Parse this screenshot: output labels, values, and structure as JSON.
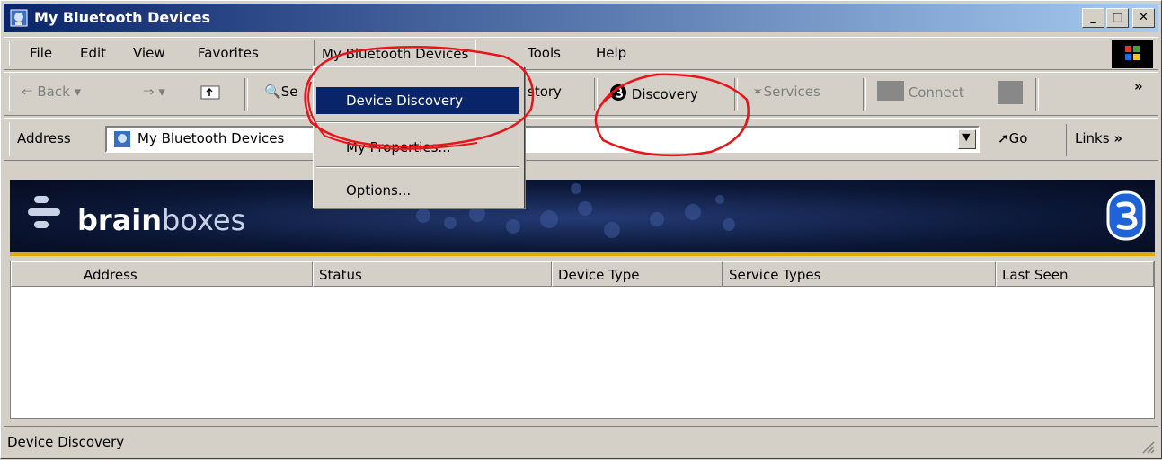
{
  "window": {
    "title": "My Bluetooth Devices"
  },
  "menubar": {
    "items": [
      "File",
      "Edit",
      "View",
      "Favorites",
      "My Bluetooth Devices",
      "Tools",
      "Help"
    ]
  },
  "toolbar": {
    "back": "Back",
    "search_partial": "Se",
    "history_partial": "story",
    "discovery": "Discovery",
    "services": "Services",
    "connect": "Connect"
  },
  "address": {
    "label": "Address",
    "value": "My Bluetooth Devices",
    "go": "Go",
    "links": "Links"
  },
  "banner": {
    "brand_bold": "brain",
    "brand_light": "boxes"
  },
  "table": {
    "columns": [
      "Address",
      "Status",
      "Device Type",
      "Service Types",
      "Last Seen"
    ]
  },
  "dropdown": {
    "items": [
      "Device Discovery",
      "My Properties...",
      "Options..."
    ]
  },
  "statusbar": {
    "text": "Device Discovery"
  },
  "colors": {
    "title_start": "#0a246a",
    "title_end": "#a6caf0",
    "highlight": "#0a246a",
    "annotation": "#e8141a",
    "banner_stripe": "#e0a800"
  }
}
